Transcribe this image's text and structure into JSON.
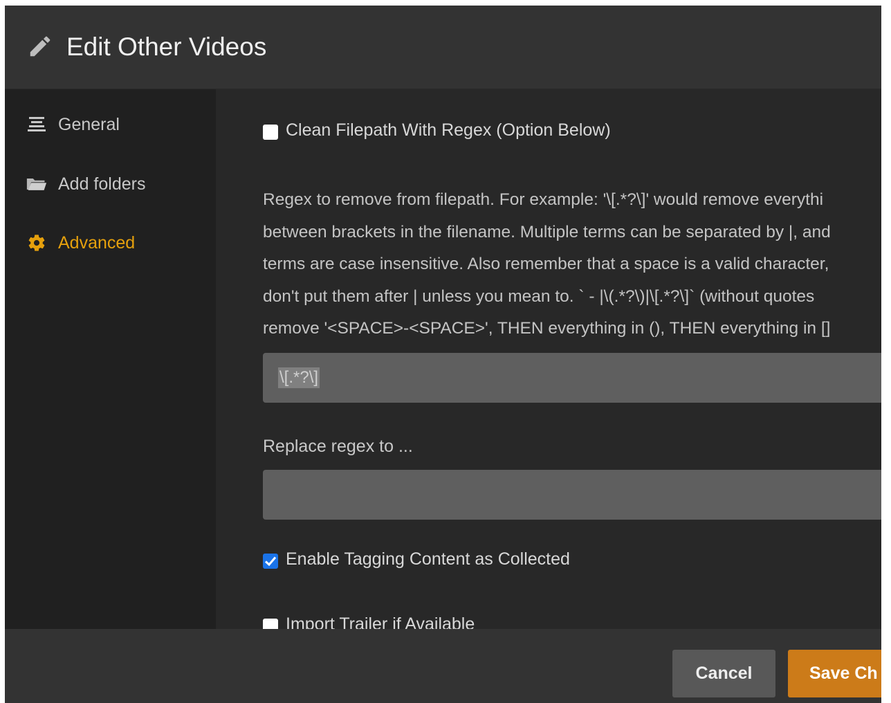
{
  "header": {
    "title": "Edit Other Videos",
    "icon": "pencil-icon"
  },
  "sidebar": {
    "items": [
      {
        "label": "General",
        "icon": "list-icon",
        "active": false
      },
      {
        "label": "Add folders",
        "icon": "folder-icon",
        "active": false
      },
      {
        "label": "Advanced",
        "icon": "gear-icon",
        "active": true
      }
    ]
  },
  "content": {
    "clean_filepath": {
      "label": "Clean Filepath With Regex (Option Below)",
      "checked": false
    },
    "help_lines": [
      "Regex to remove from filepath. For example: '\\[.*?\\]' would remove everythi",
      "between brackets in the filename. Multiple terms can be separated by |, and",
      "terms are case insensitive. Also remember that a space is a valid character,",
      "don't put them after | unless you mean to. ` - |\\(.*?\\)|\\[.*?\\]` (without quotes",
      "remove '<SPACE>-<SPACE>', THEN everything in (), THEN everything in []"
    ],
    "regex_input": {
      "value": "\\[.*?\\]"
    },
    "replace_label": "Replace regex to ...",
    "replace_input": {
      "value": ""
    },
    "tagging": {
      "label": "Enable Tagging Content as Collected",
      "checked": true
    },
    "trailer": {
      "label": "Import Trailer if Available",
      "checked": false
    }
  },
  "footer": {
    "cancel_label": "Cancel",
    "save_label": "Save Ch"
  },
  "colors": {
    "accent": "#e5a00d",
    "save_button": "#cc7b19",
    "checkbox_checked": "#1a73e8"
  }
}
